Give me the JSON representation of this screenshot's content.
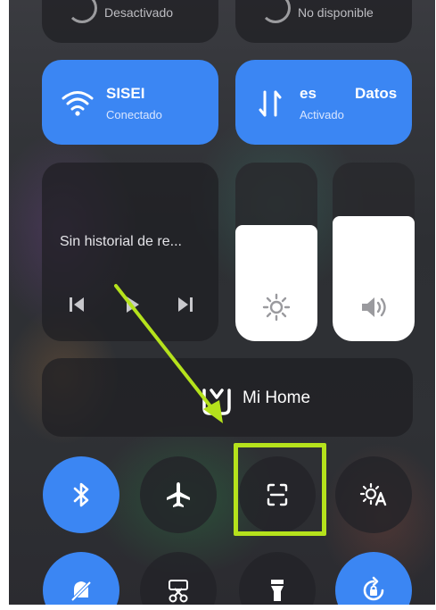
{
  "top_row": {
    "left_status": "Desactivado",
    "right_status": "No disponible"
  },
  "wifi": {
    "name": "SISEI",
    "status": "Conectado"
  },
  "mobile_data": {
    "title_part_a": "es",
    "title_part_b": "Datos",
    "status": "Activado"
  },
  "media": {
    "title": "Sin historial de re..."
  },
  "brightness": {
    "level": 0.65
  },
  "volume": {
    "level": 0.7
  },
  "mi_home": {
    "label": "Mi Home"
  },
  "toggles_row1": [
    {
      "name": "bluetooth-icon",
      "active": true
    },
    {
      "name": "airplane-icon",
      "active": false
    },
    {
      "name": "screen-capture-icon",
      "active": false
    },
    {
      "name": "auto-brightness-icon",
      "active": false
    }
  ],
  "toggles_row2": [
    {
      "name": "silent-bell-icon",
      "active": true
    },
    {
      "name": "screenshot-scissors-icon",
      "active": false
    },
    {
      "name": "flashlight-icon",
      "active": false
    },
    {
      "name": "rotation-lock-icon",
      "active": true
    }
  ],
  "colors": {
    "accent": "#3b86f3",
    "highlight": "#b5e21c"
  }
}
